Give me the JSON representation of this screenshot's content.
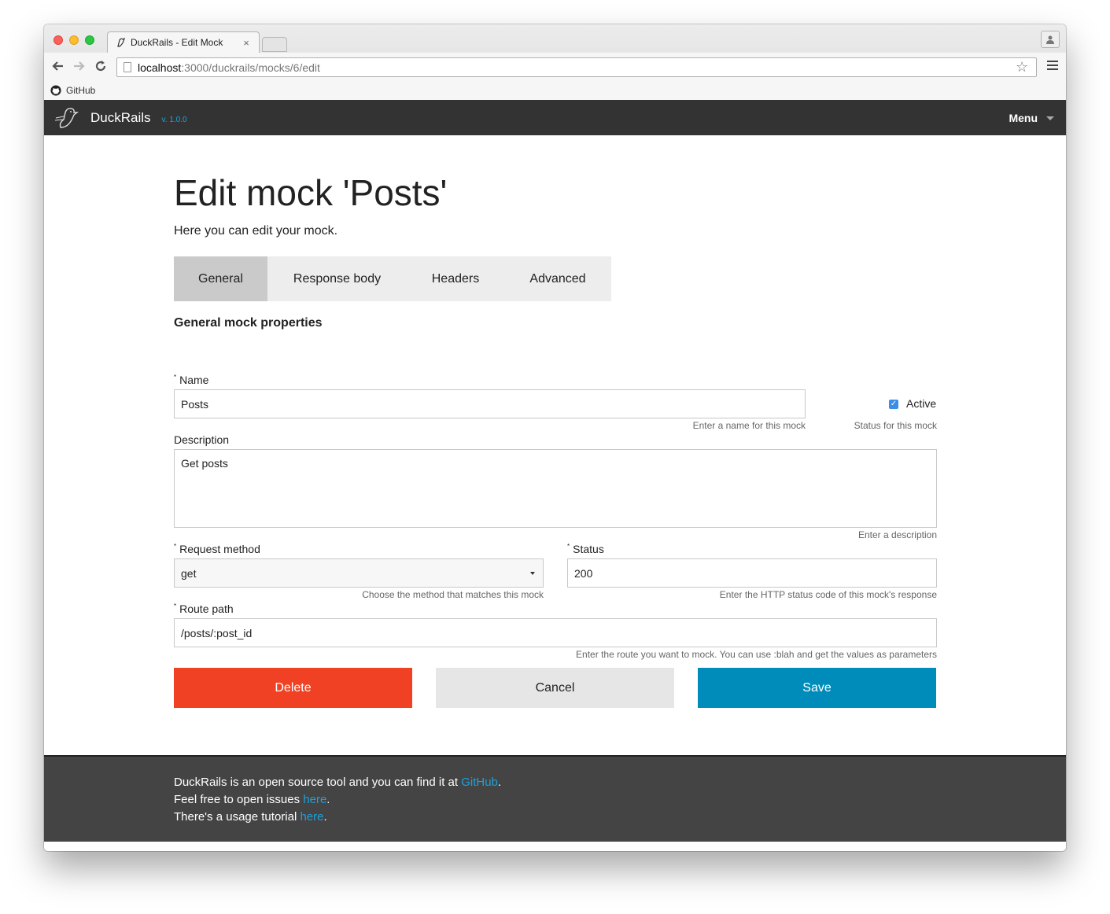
{
  "browser": {
    "tab_title": "DuckRails - Edit Mock",
    "url_host": "localhost",
    "url_rest": ":3000/duckrails/mocks/6/edit",
    "bookmark": "GitHub"
  },
  "app": {
    "brand": "DuckRails",
    "version": "v. 1.0.0",
    "menu": "Menu"
  },
  "page": {
    "title": "Edit mock 'Posts'",
    "subtitle": "Here you can edit your mock.",
    "section_title": "General mock properties"
  },
  "tabs": [
    "General",
    "Response body",
    "Headers",
    "Advanced"
  ],
  "active_tab": "General",
  "form": {
    "required_mark": "*",
    "name": {
      "label": "Name",
      "value": "Posts",
      "help": "Enter a name for this mock"
    },
    "active": {
      "label": "Active",
      "checked": true,
      "help": "Status for this mock"
    },
    "description": {
      "label": "Description",
      "value": "Get posts",
      "help": "Enter a description"
    },
    "request_method": {
      "label": "Request method",
      "value": "get",
      "help": "Choose the method that matches this mock"
    },
    "status": {
      "label": "Status",
      "value": "200",
      "help": "Enter the HTTP status code of this mock's response"
    },
    "route_path": {
      "label": "Route path",
      "value": "/posts/:post_id",
      "help": "Enter the route you want to mock. You can use :blah and get the values as parameters"
    }
  },
  "buttons": {
    "delete": "Delete",
    "cancel": "Cancel",
    "save": "Save"
  },
  "footer": {
    "line1_text": "DuckRails is an open source tool and you can find it at ",
    "line1_link": "GitHub",
    "line2_text": "Feel free to open issues ",
    "line2_link": "here",
    "line3_text": "There's a usage tutorial ",
    "line3_link": "here",
    "period": "."
  },
  "colors": {
    "navbar": "#333333",
    "accent": "#008cba",
    "danger": "#f04124",
    "link": "#1ea1d8",
    "footer": "#444444"
  }
}
